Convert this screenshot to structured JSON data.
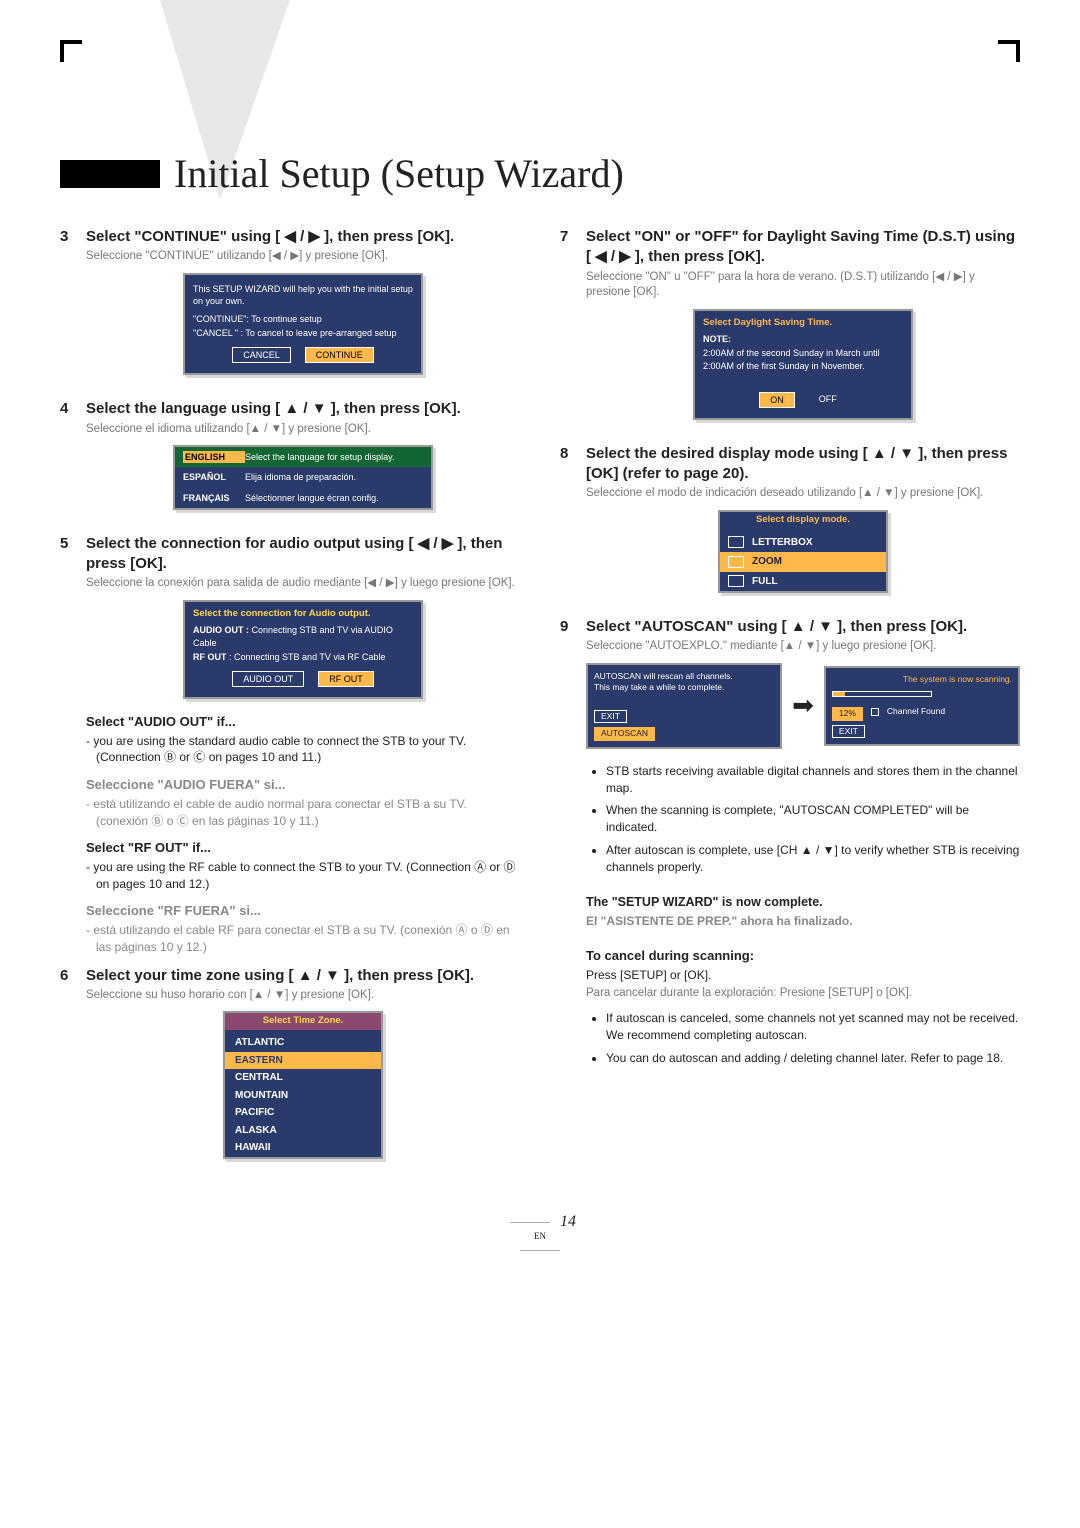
{
  "title": "Initial Setup (Setup Wizard)",
  "page_number": "14",
  "page_lang": "EN",
  "steps": {
    "s3": {
      "num": "3",
      "head": "Select \"CONTINUE\" using [ ◀ / ▶ ], then press [OK].",
      "sub": "Seleccione \"CONTINÚE\" utilizando [◀ / ▶] y presione [OK].",
      "dialog_title": "This SETUP WIZARD will help you with the initial setup on your own.",
      "d_cont": "\"CONTINUE\": To continue setup",
      "d_cancel": "\"CANCEL \" : To cancel to leave pre-arranged setup",
      "btn_cancel": "CANCEL",
      "btn_continue": "CONTINUE"
    },
    "s4": {
      "num": "4",
      "head": "Select the language using [ ▲ / ▼ ], then press [OK].",
      "sub": "Seleccione el idioma utilizando [▲ / ▼] y presione [OK].",
      "en": "ENGLISH",
      "en_t": "Select the language for setup display.",
      "es": "ESPAÑOL",
      "es_t": "Elija idioma de preparación.",
      "fr": "FRANÇAIS",
      "fr_t": "Sélectionner langue écran config."
    },
    "s5": {
      "num": "5",
      "head": "Select the connection for audio output using [ ◀ / ▶ ], then press [OK].",
      "sub": "Seleccione la conexión para salida de audio mediante [◀ / ▶] y luego presione [OK].",
      "dlg_title": "Select the connection for Audio output.",
      "audio_out_l": "AUDIO OUT :",
      "audio_out_t": "Connecting STB and TV via AUDIO Cable",
      "rf_out_l": "RF OUT",
      "rf_out_t": ": Connecting STB and TV via RF Cable",
      "btn_audio": "AUDIO OUT",
      "btn_rf": "RF OUT",
      "h_audio": "Select \"AUDIO OUT\" if...",
      "p_audio": "- you are using the standard audio cable to connect the STB to your TV. (Connection Ⓑ or Ⓒ on pages 10 and 11.)",
      "h_audio_es": "Seleccione \"AUDIO FUERA\" si...",
      "p_audio_es": "- está utilizando el cable de audio normal para conectar el STB a su TV. (conexión Ⓑ o Ⓒ en las páginas 10 y 11.)",
      "h_rf": "Select \"RF OUT\" if...",
      "p_rf": "- you are using the RF cable to connect the STB to your TV. (Connection Ⓐ or Ⓓ on pages 10 and 12.)",
      "h_rf_es": "Seleccione \"RF FUERA\" si...",
      "p_rf_es": "- está utilizando el cable RF para conectar el STB a su TV. (conexión Ⓐ o Ⓓ en las páginas 10 y 12.)"
    },
    "s6": {
      "num": "6",
      "head": "Select your time zone using [ ▲ / ▼ ], then press [OK].",
      "sub": "Seleccione su huso horario con [▲ / ▼] y presione [OK].",
      "dlg_title": "Select Time Zone.",
      "items": [
        "ATLANTIC",
        "EASTERN",
        "CENTRAL",
        "MOUNTAIN",
        "PACIFIC",
        "ALASKA",
        "HAWAII"
      ]
    },
    "s7": {
      "num": "7",
      "head": "Select \"ON\" or \"OFF\" for Daylight Saving Time (D.S.T) using [ ◀ / ▶ ], then press [OK].",
      "sub": "Seleccione \"ON\" u \"OFF\" para la hora de verano. (D.S.T) utilizando [◀ / ▶] y presione [OK].",
      "dlg_title": "Select Daylight Saving Time.",
      "note_h": "NOTE:",
      "note_t": "2:00AM of the second Sunday in March until 2:00AM of the first Sunday in November.",
      "on": "ON",
      "off": "OFF"
    },
    "s8": {
      "num": "8",
      "head": "Select the desired display mode using [ ▲ / ▼ ], then press [OK] (refer to page 20).",
      "sub": "Seleccione el modo de indicación deseado utilizando [▲ / ▼] y presione [OK].",
      "dlg_title": "Select display mode.",
      "items": [
        "LETTERBOX",
        "ZOOM",
        "FULL"
      ]
    },
    "s9": {
      "num": "9",
      "head": "Select \"AUTOSCAN\" using [ ▲ / ▼ ], then press [OK].",
      "sub": "Seleccione \"AUTOEXPLO.\" mediante [▲ / ▼] y luego presione [OK].",
      "box1_l1": "AUTOSCAN will rescan all channels.",
      "box1_l2": "This may take a while to complete.",
      "box1_exit": "EXIT",
      "box1_auto": "AUTOSCAN",
      "box2_title": "The system is now scanning.",
      "box2_pct": "12%",
      "box2_found": "Channel Found",
      "box2_exit": "EXIT",
      "b1": "STB starts receiving available digital channels and stores them in the channel map.",
      "b2": "When the scanning is complete, \"AUTOSCAN COMPLETED\" will be indicated.",
      "b3": "After autoscan is complete, use [CH ▲ / ▼] to verify whether STB is receiving channels properly.",
      "complete": "The \"SETUP WIZARD\" is now complete.",
      "complete_es": "El \"ASISTENTE DE PREP.\" ahora ha finalizado.",
      "cancel_head": "To cancel during scanning:",
      "cancel_p": "Press [SETUP] or [OK].",
      "cancel_es": "Para cancelar durante la exploración: Presione [SETUP] o [OK].",
      "cb1": "If autoscan is canceled, some channels not yet scanned may not be received. We recommend completing autoscan.",
      "cb2": "You can do autoscan and adding / deleting channel later. Refer to page 18."
    }
  }
}
